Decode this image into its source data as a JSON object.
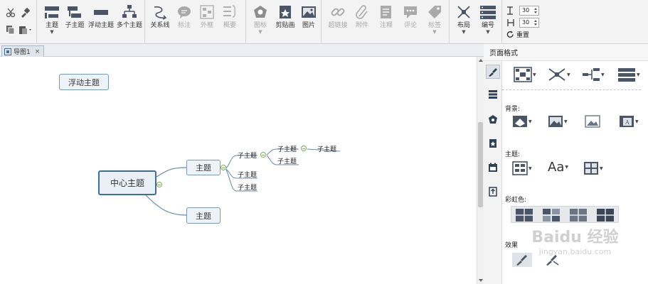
{
  "toolbar": {
    "groups": [
      {
        "name": "topic-tools",
        "items": [
          {
            "label": "主题",
            "caret": true
          },
          {
            "label": "子主题"
          },
          {
            "label": "浮动主题"
          },
          {
            "label": "多个主题"
          }
        ]
      },
      {
        "name": "relation-tools",
        "items": [
          {
            "label": "关系线"
          },
          {
            "label": "标注",
            "disabled": true
          },
          {
            "label": "外框",
            "disabled": true
          },
          {
            "label": "概要",
            "disabled": true
          }
        ]
      },
      {
        "name": "insert-tools",
        "items": [
          {
            "label": "图标",
            "disabled": true,
            "caret": true
          },
          {
            "label": "剪贴画"
          },
          {
            "label": "图片"
          }
        ]
      },
      {
        "name": "attachment-tools",
        "items": [
          {
            "label": "超链接",
            "disabled": true
          },
          {
            "label": "附件",
            "disabled": true
          },
          {
            "label": "注释",
            "disabled": true
          },
          {
            "label": "评论",
            "disabled": true
          },
          {
            "label": "标签",
            "disabled": true,
            "caret": true
          }
        ]
      },
      {
        "name": "layout-tools",
        "items": [
          {
            "label": "布局",
            "caret": true
          },
          {
            "label": "编号",
            "caret": true
          }
        ]
      }
    ],
    "spacing": {
      "horizontal": "30",
      "vertical": "30",
      "reset_label": "重置"
    }
  },
  "tab": {
    "title": "导图1",
    "close": "×"
  },
  "map": {
    "central": "中心主题",
    "floating": "浮动主题",
    "topics": [
      "主题",
      "主题"
    ],
    "subtopics_a": [
      "子主题",
      "子主题",
      "子主题"
    ],
    "subtopic_nested": [
      "子主题",
      "子主题"
    ],
    "subtopic_deep": "子主题"
  },
  "panel": {
    "title": "页面格式",
    "sections": {
      "background": "背景:",
      "theme": "主题:",
      "rainbow": "彩虹色:",
      "effect": "效果"
    },
    "text_style_glyph": "Aa"
  },
  "watermark": {
    "brand": "Baidu 经验",
    "url": "jingyan.baidu.com"
  },
  "colors": {
    "accent": "#3f6f93",
    "icon": "#4a5568",
    "collapse": "#7ab05a"
  }
}
